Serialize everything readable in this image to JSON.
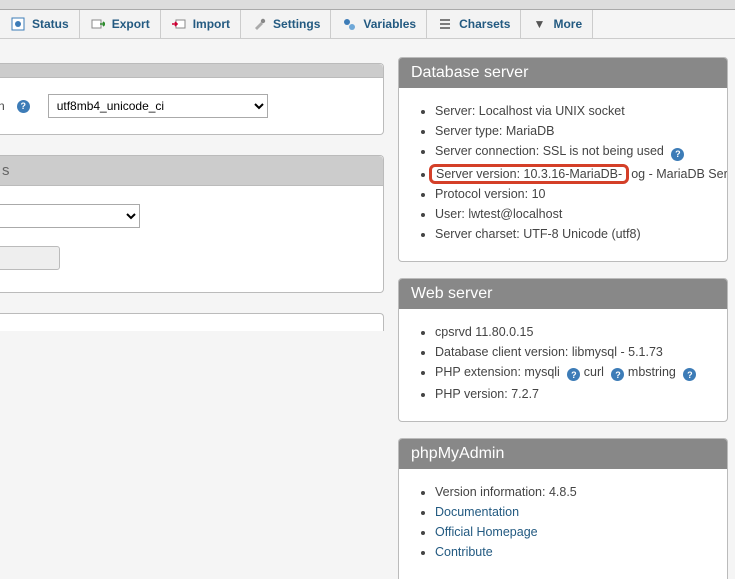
{
  "toolbar": {
    "status": "Status",
    "export": "Export",
    "import": "Import",
    "settings": "Settings",
    "variables": "Variables",
    "charsets": "Charsets",
    "more": "More"
  },
  "left": {
    "collation_select": "utf8mb4_unicode_ci",
    "lang_header": "s"
  },
  "db_server": {
    "title": "Database server",
    "server": "Server: Localhost via UNIX socket",
    "type": "Server type: MariaDB",
    "conn": "Server connection: SSL is not being used",
    "version_boxed": "Server version: 10.3.16-MariaDB-",
    "version_tail": "og - MariaDB Server",
    "protocol": "Protocol version: 10",
    "user": "User: lwtest@localhost",
    "charset": "Server charset: UTF-8 Unicode (utf8)"
  },
  "web_server": {
    "title": "Web server",
    "cpsrvd": "cpsrvd 11.80.0.15",
    "dbclient": "Database client version: libmysql - 5.1.73",
    "phpext_label": "PHP extension: ",
    "ext1": "mysqli",
    "ext2": "curl",
    "ext3": "mbstring",
    "phpver": "PHP version: 7.2.7"
  },
  "pma": {
    "title": "phpMyAdmin",
    "version": "Version information: 4.8.5",
    "doc": "Documentation",
    "home": "Official Homepage",
    "contrib": "Contribute"
  }
}
